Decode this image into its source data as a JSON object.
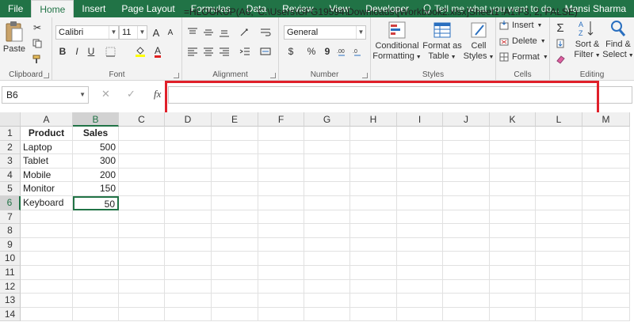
{
  "tabs": [
    "File",
    "Home",
    "Insert",
    "Page Layout",
    "Formulas",
    "Data",
    "Review",
    "View",
    "Developer"
  ],
  "active_tab": "Home",
  "tell_me": "Tell me what you want to do...",
  "user": "Mansi Sharma",
  "ribbon": {
    "clipboard": {
      "paste": "Paste",
      "label": "Clipboard"
    },
    "font": {
      "name": "Calibri",
      "size": "11",
      "bold": "B",
      "italic": "I",
      "underline": "U",
      "font_color_glyph": "A",
      "grow": "A",
      "shrink": "A",
      "label": "Font"
    },
    "alignment": {
      "label": "Alignment"
    },
    "number": {
      "format": "General",
      "percent": "%",
      "comma": "9",
      "currency": "$",
      "label": "Number"
    },
    "styles": {
      "conditional": "Conditional",
      "conditional2": "Formatting",
      "format_as": "Format as",
      "format_as2": "Table",
      "cell": "Cell",
      "cell2": "Styles",
      "label": "Styles"
    },
    "cells": {
      "insert": "Insert",
      "delete": "Delete",
      "format": "Format",
      "label": "Cells"
    },
    "editing": {
      "sigma": "Σ",
      "sort": "Sort &",
      "sort2": "Filter",
      "find": "Find &",
      "find2": "Select",
      "label": "Editing"
    }
  },
  "formula_bar": {
    "name_box": "B6",
    "cancel": "✕",
    "enter": "✓",
    "fx": "fx",
    "formula": "=HLOOKUP(A6, 'C:\\Users\\GFG19594\\Downloads\\[Workbook2.xlsx]Sheet1'!A1:F3, 2, FALSE)"
  },
  "columns": [
    "A",
    "B",
    "C",
    "D",
    "E",
    "F",
    "G",
    "H",
    "I",
    "J",
    "K",
    "L",
    "M"
  ],
  "rows": [
    "1",
    "2",
    "3",
    "4",
    "5",
    "6",
    "7",
    "8",
    "9",
    "10",
    "11",
    "12",
    "13",
    "14"
  ],
  "table": {
    "headers": [
      "Product",
      "Sales"
    ],
    "data": [
      [
        "Laptop",
        "500"
      ],
      [
        "Tablet",
        "300"
      ],
      [
        "Mobile",
        "200"
      ],
      [
        "Monitor",
        "150"
      ],
      [
        "Keyboard",
        "50"
      ]
    ]
  },
  "colors": {
    "excel_green": "#217346",
    "highlight_red": "#e0202a"
  }
}
